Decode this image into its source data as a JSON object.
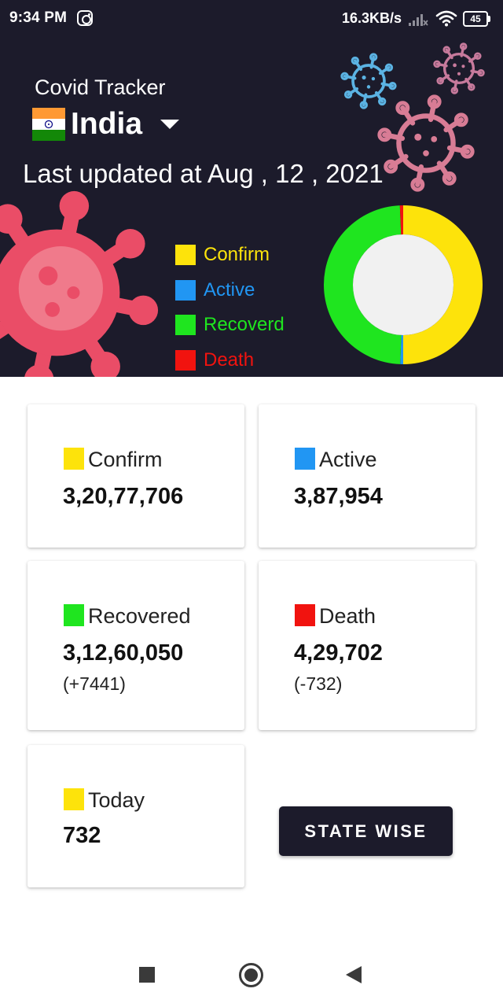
{
  "status_bar": {
    "time": "9:34 PM",
    "net_speed": "16.3KB/s",
    "battery": "45",
    "icons": [
      "instagram-icon",
      "signal-icon",
      "wifi-icon",
      "battery-icon"
    ]
  },
  "header": {
    "app_title": "Covid Tracker",
    "country": "India",
    "flag_icon": "india-flag-icon",
    "dropdown_icon": "chevron-down-icon",
    "last_updated": "Last updated at Aug , 12 , 2021",
    "background_color": "#1c1b2b"
  },
  "legend": [
    {
      "label": "Confirm",
      "color": "#fde30b"
    },
    {
      "label": "Active",
      "color": "#2196f3"
    },
    {
      "label": "Recoverd",
      "color": "#1fe51f"
    },
    {
      "label": "Death",
      "color": "#f1130f"
    }
  ],
  "donut": {
    "segments": [
      {
        "name": "Confirm",
        "value": 32077706,
        "color": "#fde30b"
      },
      {
        "name": "Active",
        "value": 387954,
        "color": "#2196f3"
      },
      {
        "name": "Recoverd",
        "value": 31260050,
        "color": "#1fe51f"
      },
      {
        "name": "Death",
        "value": 429702,
        "color": "#f1130f"
      }
    ],
    "center_color": "#f1f1f1"
  },
  "cards": {
    "confirm": {
      "label": "Confirm",
      "value": "3,20,77,706",
      "color": "#fde30b"
    },
    "active": {
      "label": "Active",
      "value": "3,87,954",
      "color": "#2196f3"
    },
    "recovered": {
      "label": "Recovered",
      "value": "3,12,60,050",
      "delta": "(+7441)",
      "color": "#1fe51f"
    },
    "death": {
      "label": "Death",
      "value": "4,29,702",
      "delta": "(-732)",
      "color": "#f1130f"
    },
    "today": {
      "label": "Today",
      "value": "732",
      "color": "#fde30b"
    }
  },
  "state_wise_button": "STATE WISE",
  "nav_bar": {
    "icons": [
      "recents-icon",
      "home-icon",
      "back-icon"
    ]
  }
}
